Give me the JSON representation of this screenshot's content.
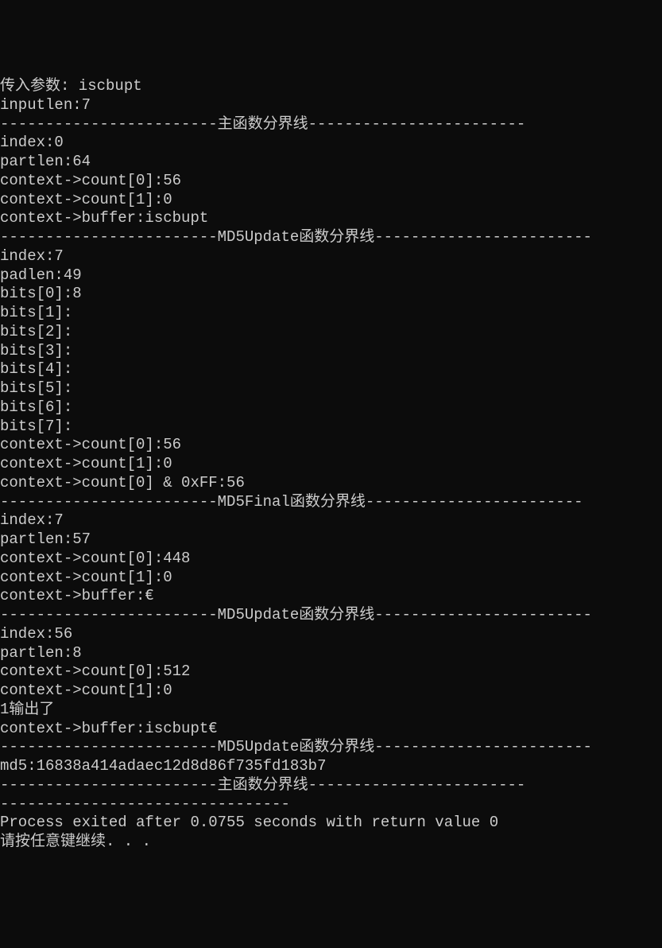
{
  "lines": [
    "传入参数: iscbupt",
    "inputlen:7",
    "------------------------主函数分界线------------------------",
    "index:0",
    "partlen:64",
    "context->count[0]:56",
    "context->count[1]:0",
    "context->buffer:iscbupt",
    "------------------------MD5Update函数分界线------------------------",
    "index:7",
    "padlen:49",
    "bits[0]:8",
    "bits[1]:",
    "bits[2]:",
    "bits[3]:",
    "bits[4]:",
    "bits[5]:",
    "bits[6]:",
    "bits[7]:",
    "context->count[0]:56",
    "context->count[1]:0",
    "context->count[0] & 0xFF:56",
    "------------------------MD5Final函数分界线------------------------",
    "index:7",
    "partlen:57",
    "context->count[0]:448",
    "context->count[1]:0",
    "context->buffer:€",
    "------------------------MD5Update函数分界线------------------------",
    "index:56",
    "partlen:8",
    "context->count[0]:512",
    "context->count[1]:0",
    "1输出了",
    "context->buffer:iscbupt€",
    "------------------------MD5Update函数分界线------------------------",
    "md5:16838a414adaec12d8d86f735fd183b7",
    "------------------------主函数分界线------------------------",
    "",
    "--------------------------------",
    "Process exited after 0.0755 seconds with return value 0",
    "请按任意键继续. . ."
  ]
}
